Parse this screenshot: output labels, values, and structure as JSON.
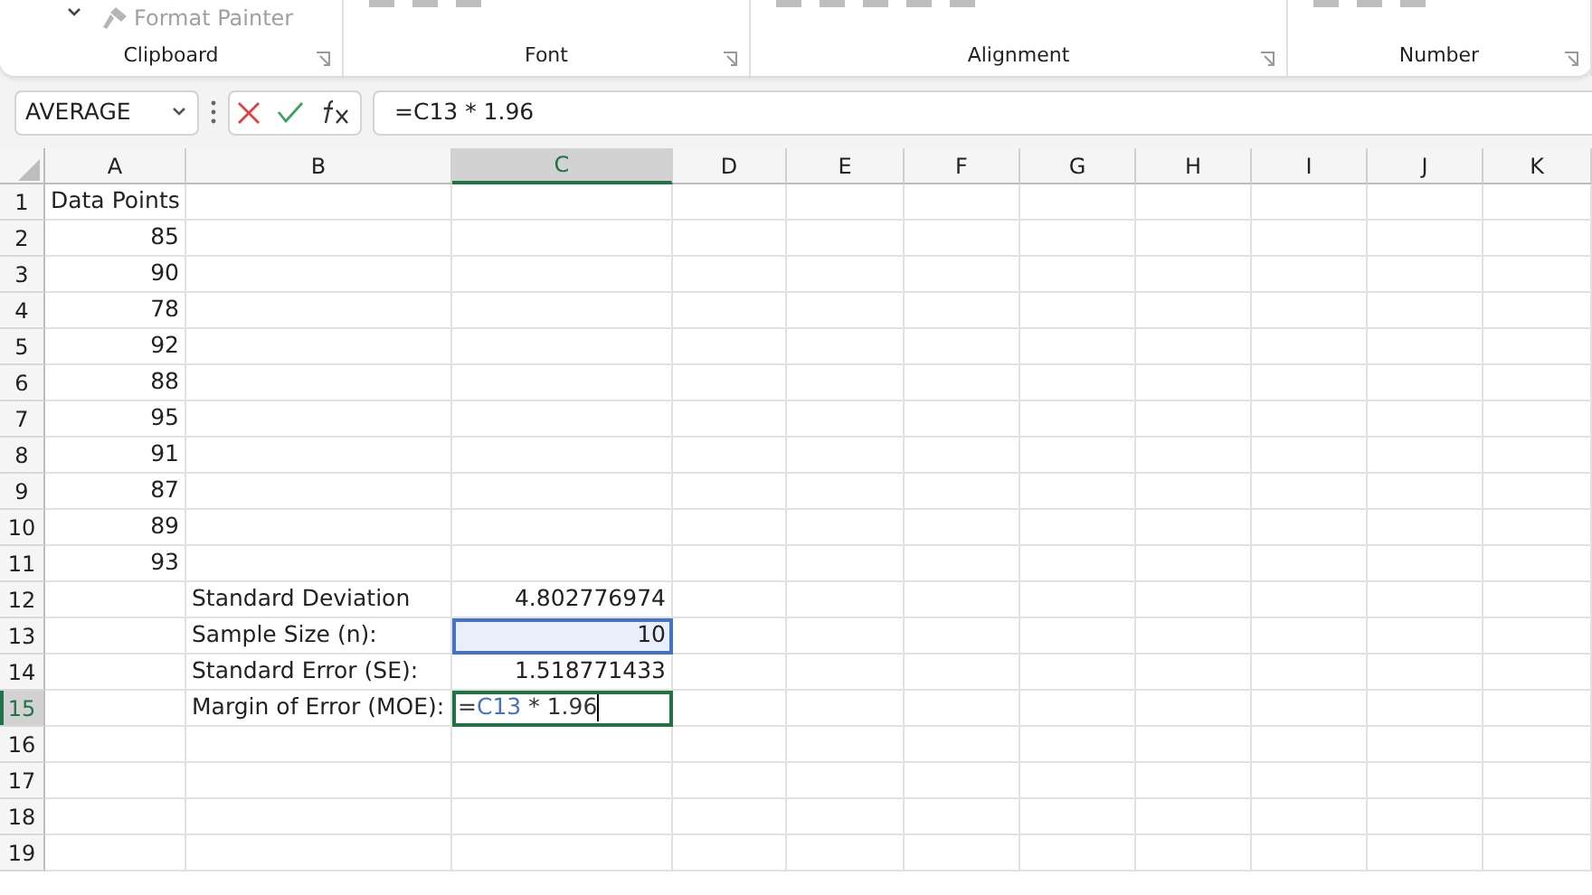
{
  "ribbon": {
    "format_painter": "Format Painter",
    "groups": [
      {
        "label": "Clipboard"
      },
      {
        "label": "Font"
      },
      {
        "label": "Alignment"
      },
      {
        "label": "Number"
      }
    ]
  },
  "name_box": {
    "value": "AVERAGE"
  },
  "formula_bar": {
    "value": "=C13 * 1.96"
  },
  "columns": [
    {
      "label": "A",
      "selected": false
    },
    {
      "label": "B",
      "selected": false
    },
    {
      "label": "C",
      "selected": true
    },
    {
      "label": "D",
      "selected": false
    },
    {
      "label": "E",
      "selected": false
    },
    {
      "label": "F",
      "selected": false
    },
    {
      "label": "G",
      "selected": false
    },
    {
      "label": "H",
      "selected": false
    },
    {
      "label": "I",
      "selected": false
    },
    {
      "label": "J",
      "selected": false
    },
    {
      "label": "K",
      "selected": false
    }
  ],
  "rows": [
    {
      "label": "1",
      "selected": false,
      "cells": {
        "a": {
          "text": "Data Points",
          "kind": "text"
        }
      }
    },
    {
      "label": "2",
      "selected": false,
      "cells": {
        "a": {
          "text": "85",
          "kind": "number"
        }
      }
    },
    {
      "label": "3",
      "selected": false,
      "cells": {
        "a": {
          "text": "90",
          "kind": "number"
        }
      }
    },
    {
      "label": "4",
      "selected": false,
      "cells": {
        "a": {
          "text": "78",
          "kind": "number"
        }
      }
    },
    {
      "label": "5",
      "selected": false,
      "cells": {
        "a": {
          "text": "92",
          "kind": "number"
        }
      }
    },
    {
      "label": "6",
      "selected": false,
      "cells": {
        "a": {
          "text": "88",
          "kind": "number"
        }
      }
    },
    {
      "label": "7",
      "selected": false,
      "cells": {
        "a": {
          "text": "95",
          "kind": "number"
        }
      }
    },
    {
      "label": "8",
      "selected": false,
      "cells": {
        "a": {
          "text": "91",
          "kind": "number"
        }
      }
    },
    {
      "label": "9",
      "selected": false,
      "cells": {
        "a": {
          "text": "87",
          "kind": "number"
        }
      }
    },
    {
      "label": "10",
      "selected": false,
      "cells": {
        "a": {
          "text": "89",
          "kind": "number"
        }
      }
    },
    {
      "label": "11",
      "selected": false,
      "cells": {
        "a": {
          "text": "93",
          "kind": "number"
        }
      }
    },
    {
      "label": "12",
      "selected": false,
      "cells": {
        "b": {
          "text": "Standard Deviation",
          "kind": "text"
        },
        "c": {
          "text": "4.802776974",
          "kind": "number"
        }
      }
    },
    {
      "label": "13",
      "selected": false,
      "cells": {
        "b": {
          "text": "Sample Size (n):",
          "kind": "text"
        },
        "c": {
          "text": "10",
          "kind": "number",
          "referenced": true
        }
      }
    },
    {
      "label": "14",
      "selected": false,
      "cells": {
        "b": {
          "text": "Standard Error (SE):",
          "kind": "text"
        },
        "c": {
          "text": "1.518771433",
          "kind": "number"
        }
      }
    },
    {
      "label": "15",
      "selected": true,
      "cells": {
        "b": {
          "text": "Margin of Error (MOE):",
          "kind": "text"
        },
        "c": {
          "kind": "formula",
          "editing": true,
          "parts": [
            {
              "text": "=",
              "ref": false
            },
            {
              "text": "C13",
              "ref": true
            },
            {
              "text": " * 1.96",
              "ref": false
            }
          ]
        }
      }
    },
    {
      "label": "16",
      "selected": false,
      "cells": {}
    },
    {
      "label": "17",
      "selected": false,
      "cells": {}
    },
    {
      "label": "18",
      "selected": false,
      "cells": {}
    },
    {
      "label": "19",
      "selected": false,
      "cells": {}
    }
  ]
}
